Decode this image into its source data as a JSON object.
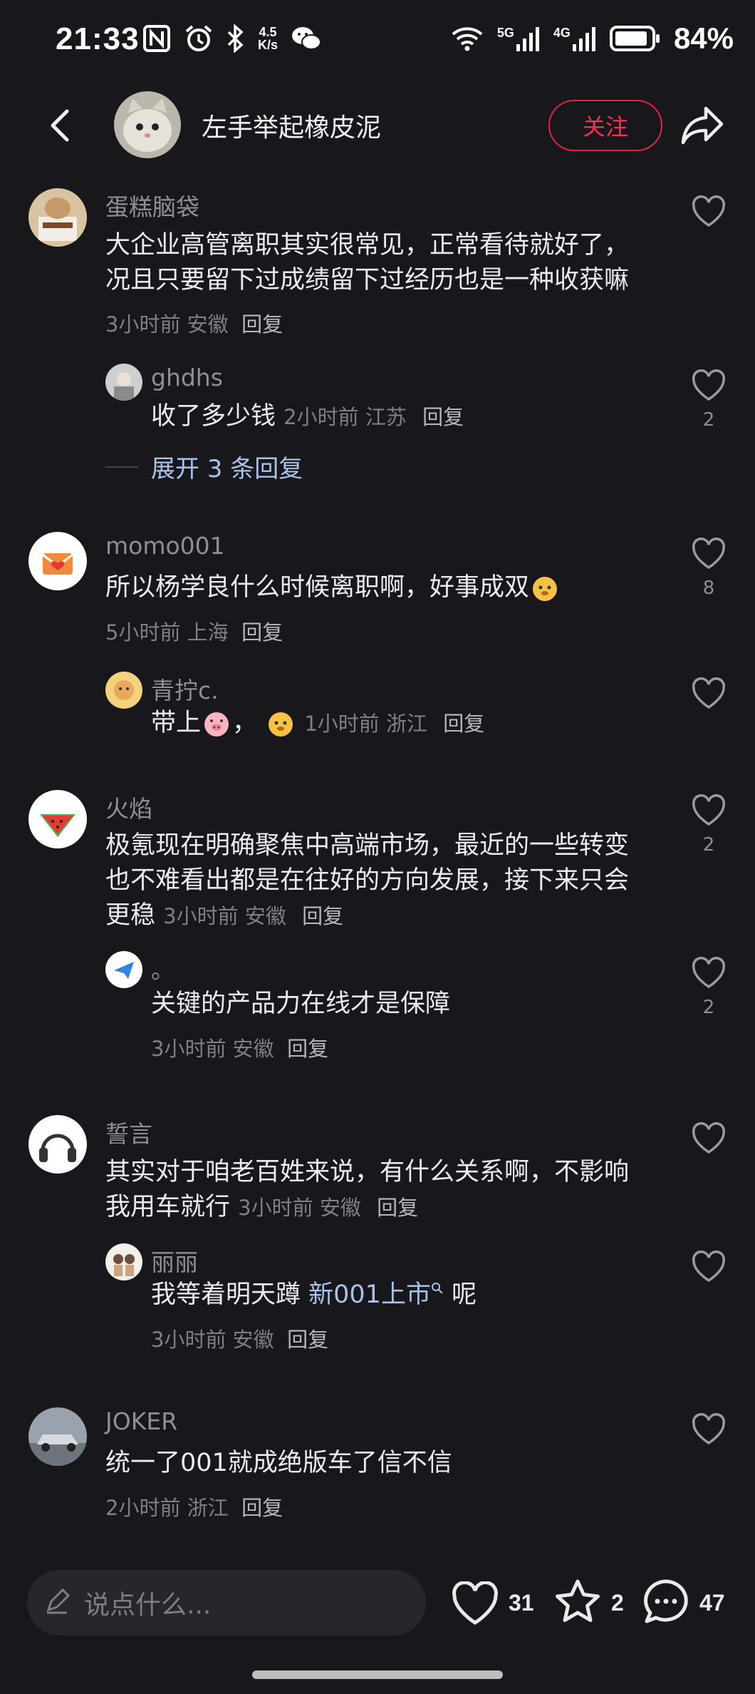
{
  "status_bar": {
    "time": "21:33",
    "net_speed_top": "4.5",
    "net_speed_bottom": "K/s",
    "battery": "84%",
    "net_5g": "5G",
    "net_4g": "4G"
  },
  "header": {
    "title": "左手举起橡皮泥",
    "follow_label": "关注"
  },
  "comments": [
    {
      "user": "蛋糕脑袋",
      "text": [
        "大企业高管离职其实很常见，正常看待就好了，",
        "况且只要留下过成绩留下过经历也是一种收获嘛"
      ],
      "meta": "3小时前 安徽",
      "reply": "回复",
      "likes": ""
    },
    {
      "user": "ghdhs",
      "text": "收了多少钱",
      "meta": "2小时前 江苏",
      "reply": "回复",
      "likes": "2"
    },
    {
      "user": "momo001",
      "text": "所以杨学良什么时候离职啊，好事成双",
      "meta": "5小时前 上海",
      "reply": "回复",
      "likes": "8"
    },
    {
      "user": "青拧c.",
      "text_a": "带上",
      "text_b": "，",
      "meta": "1小时前 浙江",
      "reply": "回复",
      "likes": ""
    },
    {
      "user": "火焰",
      "text": [
        "极氪现在明确聚焦中高端市场，最近的一些转变",
        "也不难看出都是在往好的方向发展，接下来只会",
        "更稳"
      ],
      "meta": "3小时前 安徽",
      "reply": "回复",
      "likes": "2"
    },
    {
      "user": "。",
      "text": "关键的产品力在线才是保障",
      "meta": "3小时前 安徽",
      "reply": "回复",
      "likes": "2"
    },
    {
      "user": "誓言",
      "text": [
        "其实对于咱老百姓来说，有什么关系啊，不影响",
        "我用车就行"
      ],
      "meta": "3小时前 安徽",
      "reply": "回复",
      "likes": ""
    },
    {
      "user": "丽丽",
      "text_a": "我等着明天蹲 ",
      "link": "新001上市",
      "text_b": " 呢",
      "meta": "3小时前 安徽",
      "reply": "回复",
      "likes": ""
    },
    {
      "user": "JOKER",
      "text": "统一了001就成绝版车了信不信",
      "meta": "2小时前 浙江",
      "reply": "回复",
      "likes": ""
    }
  ],
  "expand_replies": "展开 3 条回复",
  "bottom_bar": {
    "placeholder": "说点什么...",
    "likes": "31",
    "favorites": "2",
    "comments": "47"
  },
  "colors": {
    "background": "#17171c",
    "accent": "#ff2d55",
    "link": "#a8c4ea"
  }
}
